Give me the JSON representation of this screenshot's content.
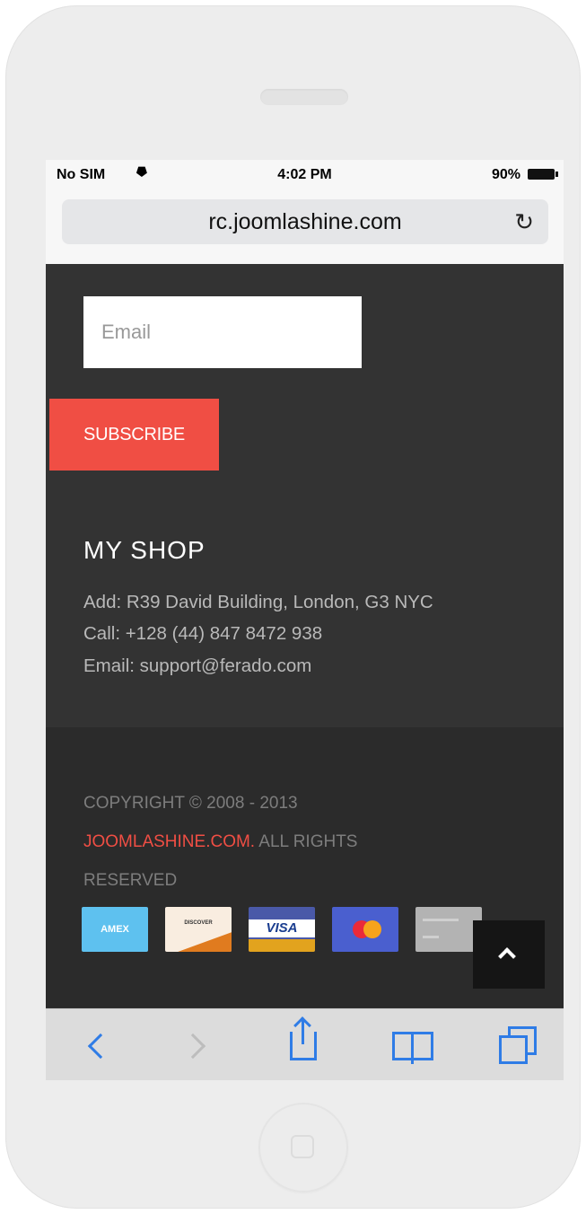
{
  "statusbar": {
    "carrier": "No SIM",
    "time": "4:02 PM",
    "battery": "90%"
  },
  "browser": {
    "url": "rc.joomlashine.com"
  },
  "newsletter": {
    "email_placeholder": "Email",
    "subscribe_label": "SUBSCRIBE"
  },
  "shop": {
    "title": "MY SHOP",
    "address": "Add: R39 David Building, London, G3 NYC",
    "phone": "Call: +128 (44) 847 8472 938",
    "email": "Email: support@ferado.com"
  },
  "copyright": {
    "line1": "COPYRIGHT © 2008 - 2013",
    "brand": "JOOMLASHINE.COM.",
    "rest": " ALL RIGHTS",
    "line3": "RESERVED"
  },
  "cards": {
    "amex": "AMEX",
    "discover": "DISCOVER",
    "visa": "VISA"
  },
  "colors": {
    "accent": "#f04e44",
    "footer_bg": "#333333",
    "footer_bottom_bg": "#2b2b2b",
    "ios_blue": "#2f7ce6"
  },
  "icons": [
    "wifi-icon",
    "battery-icon",
    "reload-icon",
    "chevron-up-icon",
    "back-icon",
    "forward-icon",
    "share-icon",
    "bookmarks-icon",
    "tabs-icon"
  ]
}
